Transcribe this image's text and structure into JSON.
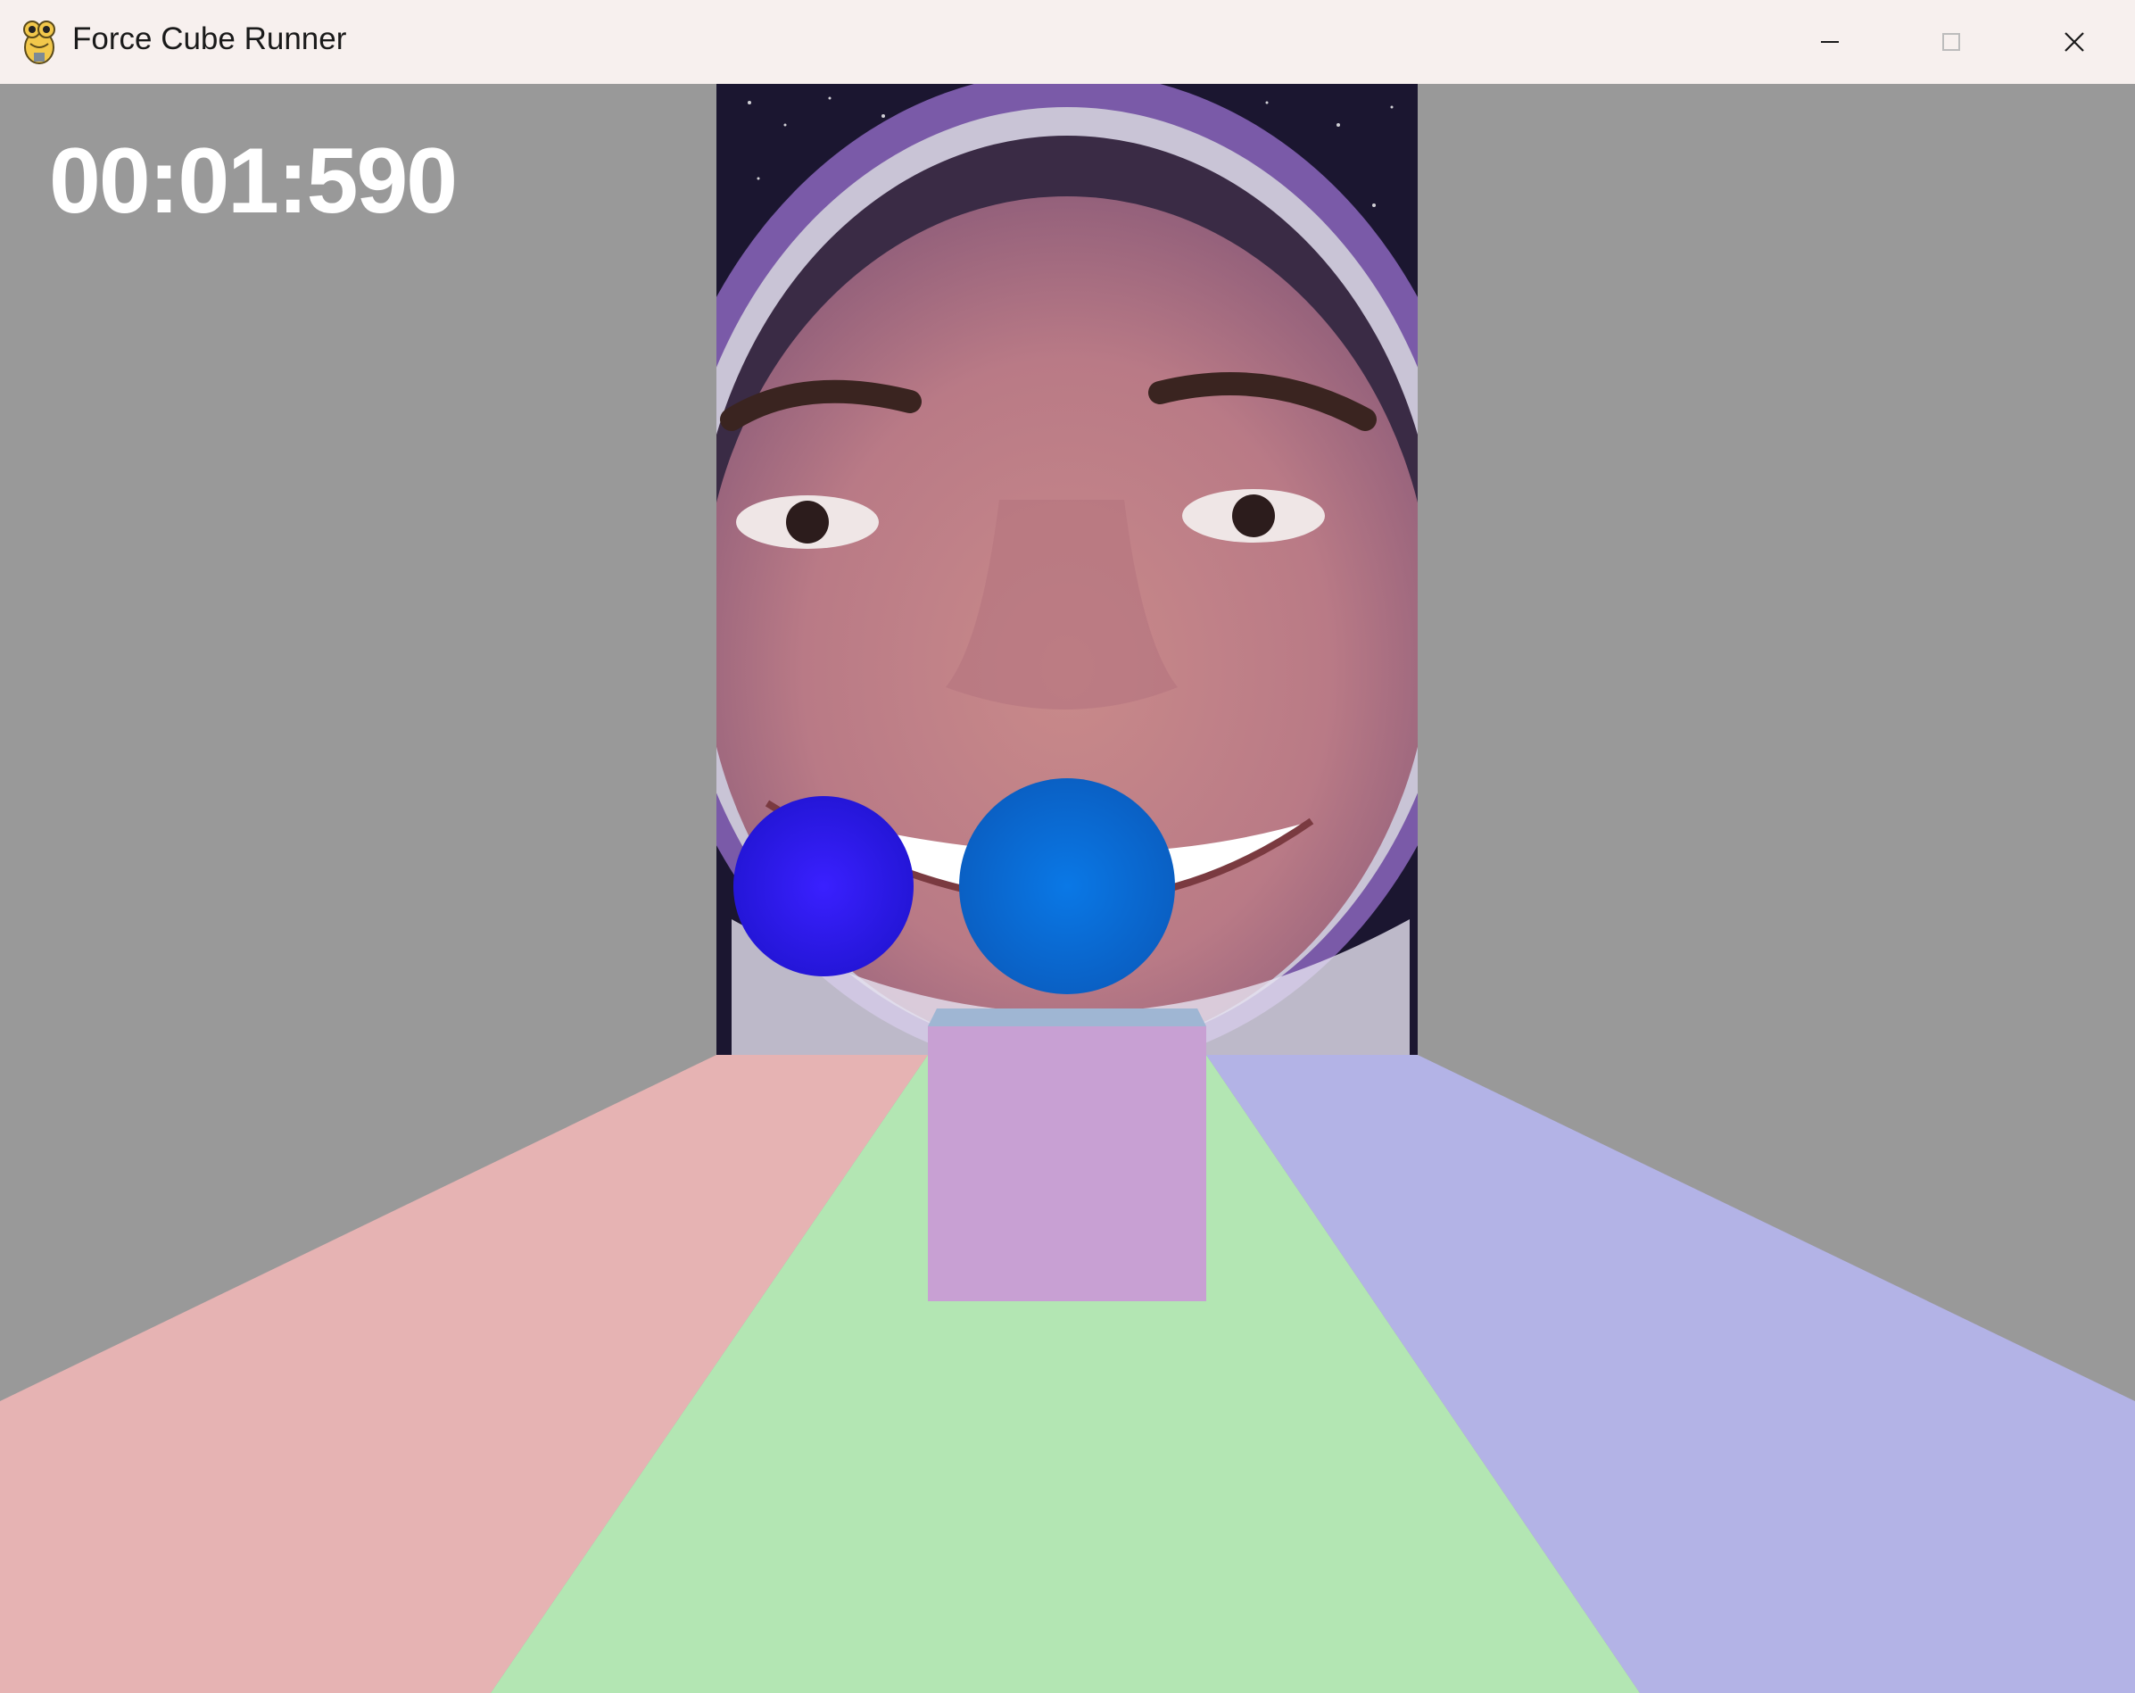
{
  "window": {
    "title": "Force Cube Runner",
    "controls": {
      "minimize": "minimize",
      "maximize": "maximize",
      "close": "close"
    }
  },
  "hud": {
    "timer": "00:01:590"
  },
  "scene": {
    "background_color": "#999999",
    "lanes": [
      {
        "name": "left-lane",
        "color": "#e6b3b3"
      },
      {
        "name": "center-lane",
        "color": "#b3e6b3"
      },
      {
        "name": "right-lane",
        "color": "#b3b3e6"
      }
    ],
    "player_cube": {
      "front_color": "#c8a0d3",
      "top_color": "#9fb6d3"
    },
    "orbs": [
      {
        "name": "left-orb",
        "color": "#2a1ae8"
      },
      {
        "name": "right-orb",
        "color": "#0a6fd6"
      }
    ],
    "backdrop_image": "astronaut-face-in-helmet"
  }
}
